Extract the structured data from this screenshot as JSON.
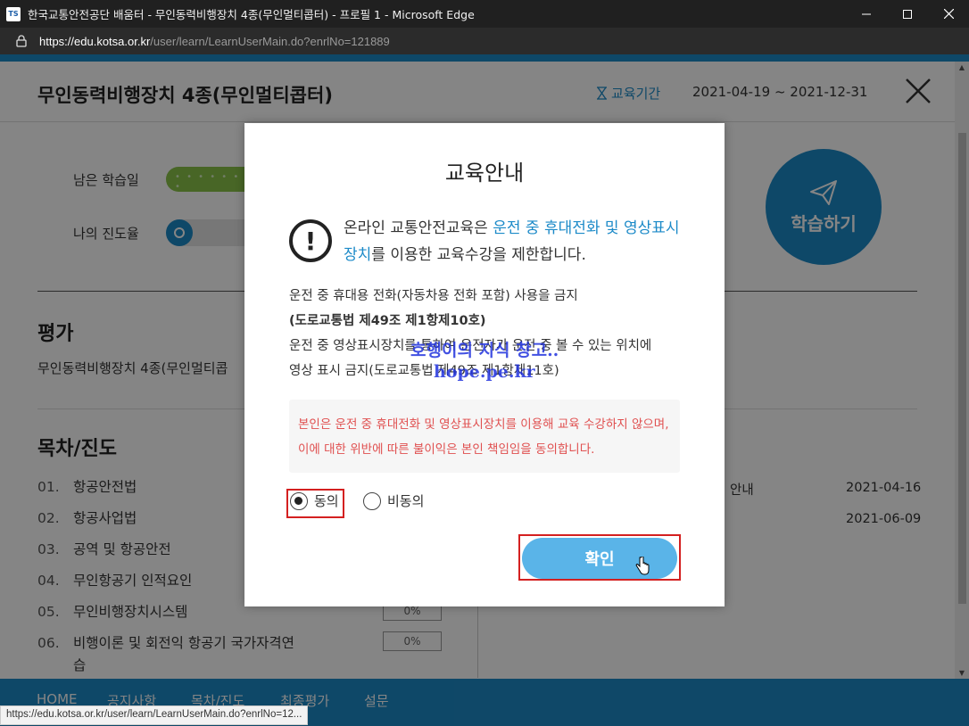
{
  "window": {
    "title": "한국교통안전공단 배움터 - 무인동력비행장치 4종(무인멀티콥터) - 프로필 1 - Microsoft Edge",
    "app_icon_text": "TS",
    "url_host": "https://edu.kotsa.or.kr",
    "url_path": "/user/learn/LearnUserMain.do?enrlNo=121889"
  },
  "header": {
    "course_title": "무인동력비행장치 4종(무인멀티콥터)",
    "period_label": "교육기간",
    "period_value": "2021-04-19 ~ 2021-12-31"
  },
  "progress": {
    "remaining_days_label": "남은 학습일",
    "my_progress_label": "나의 진도율",
    "study_button": "학습하기"
  },
  "evaluation": {
    "title": "평가",
    "course_text": "무인동력비행장치 4종(무인멀티콥"
  },
  "toc": {
    "title": "목차/진도",
    "items": [
      {
        "num": "01.",
        "label": "항공안전법"
      },
      {
        "num": "02.",
        "label": "항공사업법"
      },
      {
        "num": "03.",
        "label": "공역 및 항공안전"
      },
      {
        "num": "04.",
        "label": "무인항공기 인적요인"
      },
      {
        "num": "05.",
        "label": "무인비행장치시스템",
        "pct": "0%"
      },
      {
        "num": "06.",
        "label": "비행이론 및 회전익 항공기 국가자격연",
        "label2": "습",
        "pct": "0%"
      }
    ]
  },
  "notices": [
    {
      "label": "안내",
      "date": "2021-04-16"
    },
    {
      "label": "",
      "date": "2021-06-09"
    }
  ],
  "footer_nav": [
    "HOME",
    "공지사항",
    "목차/진도",
    "최종평가",
    "설문"
  ],
  "status_url": "https://edu.kotsa.or.kr/user/learn/LearnUserMain.do?enrlNo=12...",
  "modal": {
    "title": "교육안내",
    "warn_part1": "온라인 교통안전교육은 ",
    "warn_blue": "운전 중 휴대전화 및 영상표시장치",
    "warn_part2": "를 이용한 교육수강을 제한합니다.",
    "rule1": "운전 중 휴대용 전화(자동차용 전화 포함) 사용을 금지",
    "rule1_law": "(도로교통법 제49조 제1항제10호)",
    "rule2": "운전 중 영상표시장치를 통하여 운전자가 운전 중 볼 수 있는 위치에",
    "rule2_law": "영상 표시 금지(도로교통법 제49조 제1항제11호)",
    "watermark_line1": "호행이의 지식 창고..",
    "watermark_line2": "hope.pe.kr",
    "consent_text": "본인은 운전 중 휴대전화 및 영상표시장치를 이용해 교육 수강하지 않으며, 이에 대한 위반에 따른 불이익은 본인 책임임을 동의합니다.",
    "agree_label": "동의",
    "disagree_label": "비동의",
    "confirm_label": "확인"
  },
  "colors": {
    "brand": "#1c8ac8",
    "consent_text": "#e05050",
    "highlight": "#d42020",
    "confirm_button": "#5ab4e8"
  }
}
